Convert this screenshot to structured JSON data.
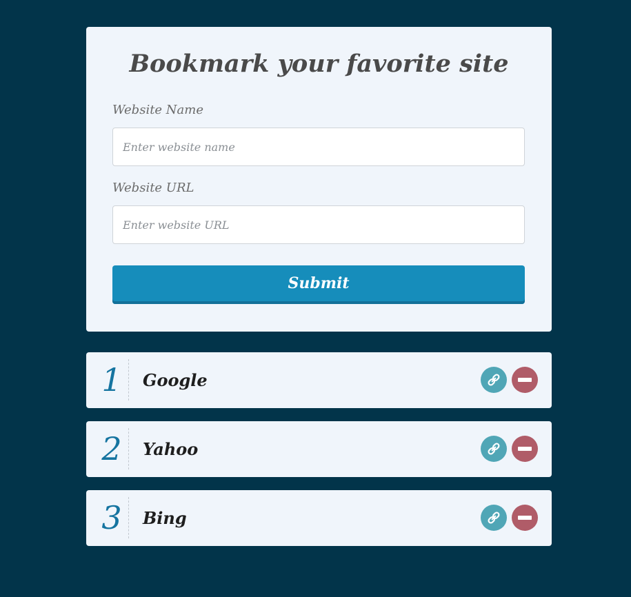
{
  "form": {
    "title": "Bookmark your favorite site",
    "name_label": "Website Name",
    "name_placeholder": "Enter website name",
    "name_value": "",
    "url_label": "Website URL",
    "url_placeholder": "Enter website URL",
    "url_value": "",
    "submit_label": "Submit"
  },
  "bookmarks": [
    {
      "index": "1",
      "name": "Google",
      "visit_icon": "link-icon",
      "delete_icon": "minus-circle-icon"
    },
    {
      "index": "2",
      "name": "Yahoo",
      "visit_icon": "link-icon",
      "delete_icon": "minus-circle-icon"
    },
    {
      "index": "3",
      "name": "Bing",
      "visit_icon": "link-icon",
      "delete_icon": "minus-circle-icon"
    }
  ],
  "colors": {
    "background": "#02344a",
    "card": "#f0f5fb",
    "submit": "#168dbb",
    "index_number": "#1574a0",
    "visit_button": "#50a6b6",
    "delete_button": "#b05c68"
  }
}
